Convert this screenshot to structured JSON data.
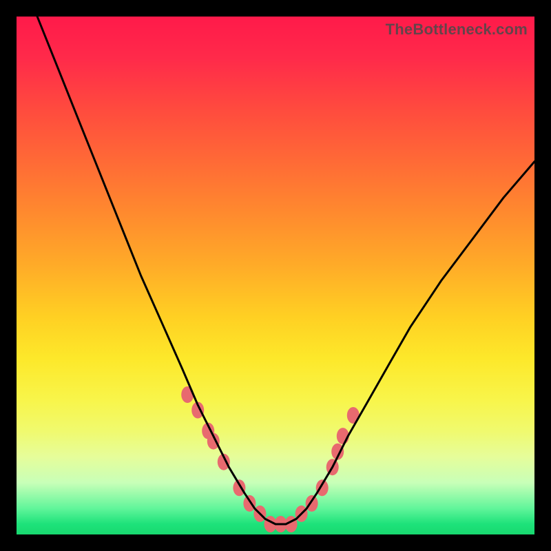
{
  "watermark": "TheBottleneck.com",
  "colors": {
    "marker": "#e86a6f",
    "curve": "#000000",
    "frame": "#000000"
  },
  "chart_data": {
    "type": "line",
    "title": "",
    "xlabel": "",
    "ylabel": "",
    "xlim": [
      0,
      100
    ],
    "ylim": [
      0,
      100
    ],
    "grid": false,
    "legend": false,
    "series": [
      {
        "name": "bottleneck-curve",
        "x": [
          0,
          4,
          8,
          12,
          16,
          20,
          24,
          28,
          32,
          35,
          38,
          41,
          44,
          46,
          48,
          50,
          52,
          54,
          56,
          58,
          61,
          64,
          68,
          72,
          76,
          82,
          88,
          94,
          100
        ],
        "y": [
          110,
          100,
          90,
          80,
          70,
          60,
          50,
          41,
          32,
          25,
          19,
          13,
          8,
          5,
          3,
          2,
          2,
          3,
          5,
          8,
          13,
          19,
          26,
          33,
          40,
          49,
          57,
          65,
          72
        ]
      }
    ],
    "markers": {
      "name": "highlight-points",
      "x": [
        33,
        35,
        37,
        38,
        40,
        43,
        45,
        47,
        49,
        51,
        53,
        55,
        57,
        59,
        61,
        62,
        63,
        65
      ],
      "y": [
        27,
        24,
        20,
        18,
        14,
        9,
        6,
        4,
        2,
        2,
        2,
        4,
        6,
        9,
        13,
        16,
        19,
        23
      ]
    }
  }
}
